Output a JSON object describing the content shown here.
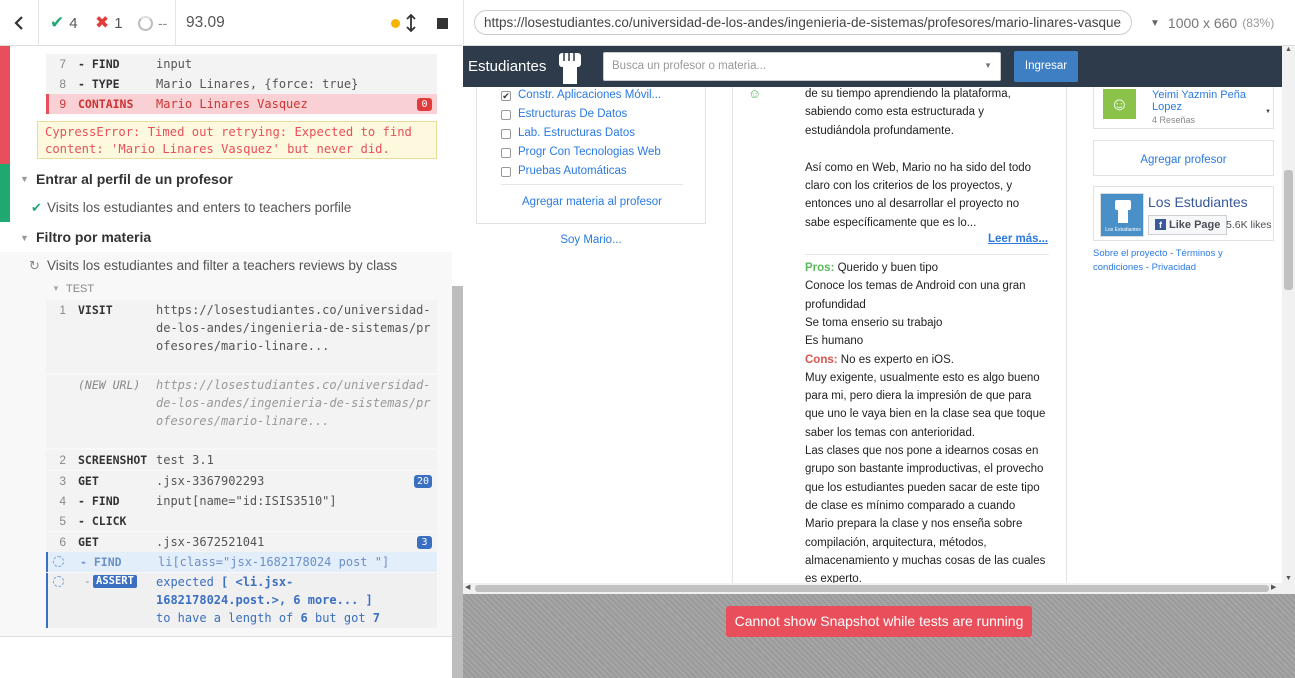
{
  "toolbar": {
    "passed": "4",
    "failed": "1",
    "pending": "--",
    "duration": "93.09",
    "url": "https://losestudiantes.co/universidad-de-los-andes/ingenieria-de-sistemas/profesores/mario-linares-vasque",
    "viewport": "1000 x 660",
    "scale": "(83%)"
  },
  "reporter": {
    "prev_cmds": [
      {
        "num": "8",
        "name": "- TYPE",
        "msg": "Mario Linares, {force: true}"
      },
      {
        "num": "7",
        "name": "- FIND",
        "msg": "input"
      }
    ],
    "failed_cmd": {
      "num": "9",
      "name": "CONTAINS",
      "msg": "Mario Linares Vasquez",
      "badge": "0"
    },
    "error": "CypressError: Timed out retrying: Expected to find content: 'Mario Linares Vasquez' but never did.",
    "suite1": {
      "title": "Entrar al perfil de un profesor",
      "test": "Visits los estudiantes and enters to teachers porfile"
    },
    "suite2": {
      "title": "Filtro por materia",
      "test": "Visits los estudiantes and filter a teachers reviews by class"
    },
    "test_label": "TEST",
    "cmds": {
      "visit_num": "1",
      "visit_name": "VISIT",
      "visit_msg": "https://losestudiantes.co/universidad-de-los-andes/ingenieria-de-sistemas/profesores/mario-linare...",
      "newurl_name": "(NEW URL)",
      "newurl_msg": "https://losestudiantes.co/universidad-de-los-andes/ingenieria-de-sistemas/profesores/mario-linare...",
      "shot_num": "2",
      "shot_name": "SCREENSHOT",
      "shot_msg": "test 3.1",
      "get1_num": "3",
      "get1_name": "GET",
      "get1_msg": ".jsx-3367902293",
      "get1_badge": "20",
      "find1_num": "4",
      "find1_name": "- FIND",
      "find1_msg": "input[name=\"id:ISIS3510\"]",
      "click_num": "5",
      "click_name": "- CLICK",
      "get2_num": "6",
      "get2_name": "GET",
      "get2_msg": ".jsx-3672521041",
      "get2_badge": "3",
      "find2_name": "- FIND",
      "find2_msg": "li[class=\"jsx-1682178024 post \"]",
      "assert_name": "ASSERT",
      "assert_l1": "expected",
      "assert_l1b": "[ <li.jsx-",
      "assert_l2": "1682178024.post.>, 6 more... ]",
      "assert_l3a": "to have a length of",
      "assert_l3b": "6",
      "assert_l3c": "but got",
      "assert_l3d": "7"
    }
  },
  "app": {
    "brand": "Estudiantes",
    "search_placeholder": "Busca un profesor o materia...",
    "login": "Ingresar",
    "subjects": [
      {
        "label": "Constr. Aplicaciones Móvil...",
        "checked": true
      },
      {
        "label": "Estructuras De Datos",
        "checked": false
      },
      {
        "label": "Lab. Estructuras Datos",
        "checked": false
      },
      {
        "label": "Progr Con Tecnologias Web",
        "checked": false
      },
      {
        "label": "Pruebas Automáticas",
        "checked": false
      }
    ],
    "add_subject": "Agregar materia al profesor",
    "soy": "Soy Mario...",
    "review_lines": [
      "de su tiempo aprendiendo la plataforma,",
      "sabiendo como esta estructurada y",
      "estudiándola profundamente.",
      "",
      "Así como en Web, Mario no ha sido del todo",
      "claro con los criterios de los proyectos, y",
      "entonces uno al desarrollar el proyecto no",
      "sabe específicamente que es lo..."
    ],
    "read_more": "Leer más...",
    "pros_label": "Pros:",
    "pros_first": "Querido y buen tipo",
    "pros_lines": [
      "Conoce los temas de Android con una gran",
      "profundidad",
      "Se toma enserio su trabajo",
      "Es humano"
    ],
    "cons_label": "Cons:",
    "cons_first": "No es experto en iOS.",
    "cons_lines": [
      "Muy exigente, usualmente esto es algo bueno",
      "para mi, pero diera la impresión de que para",
      "que uno le vaya bien en la clase sea que toque",
      "saber los temas con anterioridad.",
      "Las clases que nos pone a idearnos cosas en",
      "grupo son bastante improductivas, el provecho",
      "que los estudiantes pueden sacar de este tipo",
      "de clase es mínimo comparado a cuando",
      "Mario prepara la clase y nos enseña sobre",
      "compilación, arquitectura, métodos,",
      "almacenamiento y muchas cosas de las cuales",
      "es experto."
    ],
    "prof_name": "Yeimi Yazmin Peña Lopez",
    "prof_reviews": "4 Reseñas",
    "add_prof": "Agregar profesor",
    "fb_title": "Los Estudiantes",
    "fb_like": "Like Page",
    "fb_count": "5.6K likes",
    "fb_logo_text": "Los Estudiantes",
    "footer1": "Sobre el proyecto",
    "footer_dash1": " - ",
    "footer2": "Términos y condiciones",
    "footer_dash2": " - ",
    "footer3": "Privacidad"
  },
  "snapshot_msg": "Cannot show Snapshot while tests are running"
}
